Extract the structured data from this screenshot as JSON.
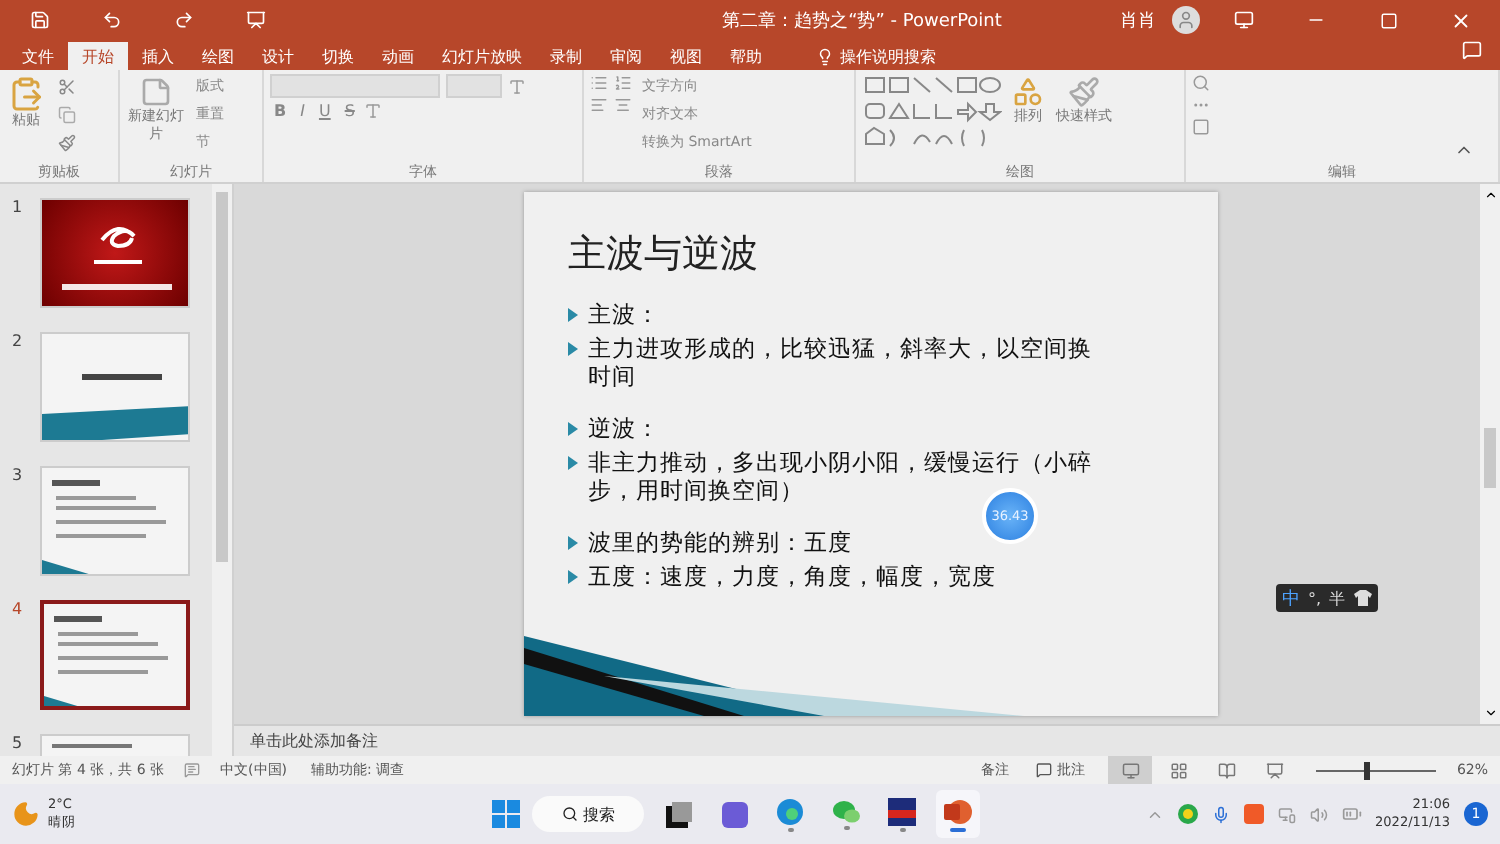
{
  "window": {
    "title": "第二章：趋势之“势” - PowerPoint",
    "user": "肖肖"
  },
  "ribbon_tabs": [
    {
      "label": "文件",
      "selected": false
    },
    {
      "label": "开始",
      "selected": true
    },
    {
      "label": "插入",
      "selected": false
    },
    {
      "label": "绘图",
      "selected": false
    },
    {
      "label": "设计",
      "selected": false
    },
    {
      "label": "切换",
      "selected": false
    },
    {
      "label": "动画",
      "selected": false
    },
    {
      "label": "幻灯片放映",
      "selected": false
    },
    {
      "label": "录制",
      "selected": false
    },
    {
      "label": "审阅",
      "selected": false
    },
    {
      "label": "视图",
      "selected": false
    },
    {
      "label": "帮助",
      "selected": false
    }
  ],
  "tell_me": "操作说明搜索",
  "clipboard": {
    "label": "剪贴板",
    "paste": "粘贴"
  },
  "slides_group": {
    "label": "幻灯片",
    "new_slide": "新建幻灯片",
    "layout": "版式",
    "reset": "重置",
    "section": "节"
  },
  "font_group": {
    "label": "字体",
    "format_buttons": [
      "B",
      "I",
      "U",
      "S"
    ]
  },
  "paragraph_group": {
    "label": "段落",
    "text_direction": "文字方向",
    "align_text": "对齐文本",
    "smartart": "转换为 SmartArt"
  },
  "drawing_group": {
    "label": "绘图",
    "arrange": "排列",
    "quick_styles": "快速样式"
  },
  "editing_group": {
    "label": "编辑"
  },
  "thumbnails": [
    {
      "number": "1",
      "kind": "title",
      "selected": false
    },
    {
      "number": "2",
      "kind": "section",
      "selected": false
    },
    {
      "number": "3",
      "kind": "content",
      "selected": false
    },
    {
      "number": "4",
      "kind": "content",
      "selected": true
    },
    {
      "number": "5",
      "kind": "partial",
      "selected": false
    }
  ],
  "slide": {
    "title": "主波与逆波",
    "bullet_groups": [
      [
        "主波：",
        "主力进攻形成的，比较迅猛，斜率大，以空间换时间"
      ],
      [
        "逆波：",
        "非主力推动，多出现小阴小阳，缓慢运行（小碎步，用时间换空间）"
      ],
      [
        "波里的势能的辨别：五度",
        "五度：速度，力度，角度，幅度，宽度"
      ]
    ]
  },
  "timer": "36.43",
  "ime": {
    "mode": "中",
    "punctuation": "°,",
    "width": "半"
  },
  "notes_placeholder": "单击此处添加备注",
  "status_bar": {
    "slide_info": "幻灯片 第 4 张，共 6 张",
    "language": "中文(中国)",
    "accessibility": "辅助功能: 调查",
    "notes": "备注",
    "comments": "批注",
    "views": [
      {
        "kind": "normal",
        "selected": true
      },
      {
        "kind": "sorter",
        "selected": false
      },
      {
        "kind": "reading",
        "selected": false
      },
      {
        "kind": "slideshow",
        "selected": false
      }
    ],
    "zoom": {
      "level": 0.4,
      "reading": "62%"
    }
  },
  "taskbar": {
    "weather": {
      "temperature": "2°C",
      "condition": "晴阴"
    },
    "search": "搜索",
    "apps": [
      {
        "kind": "taskview",
        "running": false,
        "selected": false
      },
      {
        "kind": "chat",
        "running": false,
        "selected": false
      },
      {
        "kind": "edge",
        "running": true,
        "selected": false
      },
      {
        "kind": "wechat",
        "running": true,
        "selected": false
      },
      {
        "kind": "stock",
        "running": true,
        "selected": false
      },
      {
        "kind": "powerpoint",
        "running": true,
        "selected": true
      }
    ],
    "time": "21:06",
    "date": "2022/11/13",
    "notifications": "1"
  }
}
